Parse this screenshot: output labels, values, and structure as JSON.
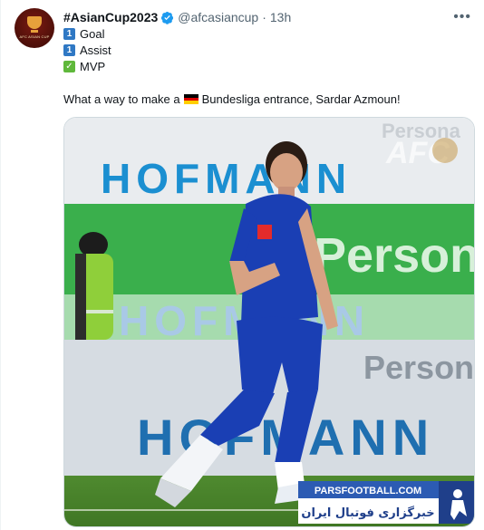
{
  "account": {
    "name": "#AsianCup2023",
    "handle": "@afcasiancup",
    "separator": "·",
    "time": "13h",
    "avatar_text": "AFC ASIAN CUP"
  },
  "tweet": {
    "line1": {
      "icon": "keycap-1",
      "keycap": "1",
      "text": "Goal"
    },
    "line2": {
      "icon": "keycap-1",
      "keycap": "1",
      "text": "Assist"
    },
    "line3": {
      "icon": "check-mark",
      "mark": "✓",
      "text": "MVP"
    },
    "body_before": "What a way to make a",
    "body_after": "Bundesliga entrance, Sardar Azmoun!"
  },
  "media": {
    "board_top": "HOFMANN",
    "board_top_right": "Persona",
    "green_board": "Person",
    "board_mid": "HOFMANN",
    "board_low_right": "Person",
    "board_low": "HOFMANN",
    "watermark": "AFC",
    "badge_brand": "PARSFOOTBALL.COM",
    "badge_text": "خبرگزاری فوتبال ایران"
  },
  "colors": {
    "verified": "#1d9bf0",
    "keycap": "#2f78c4",
    "check": "#5fb83b",
    "jersey": "#1a3fb4"
  }
}
